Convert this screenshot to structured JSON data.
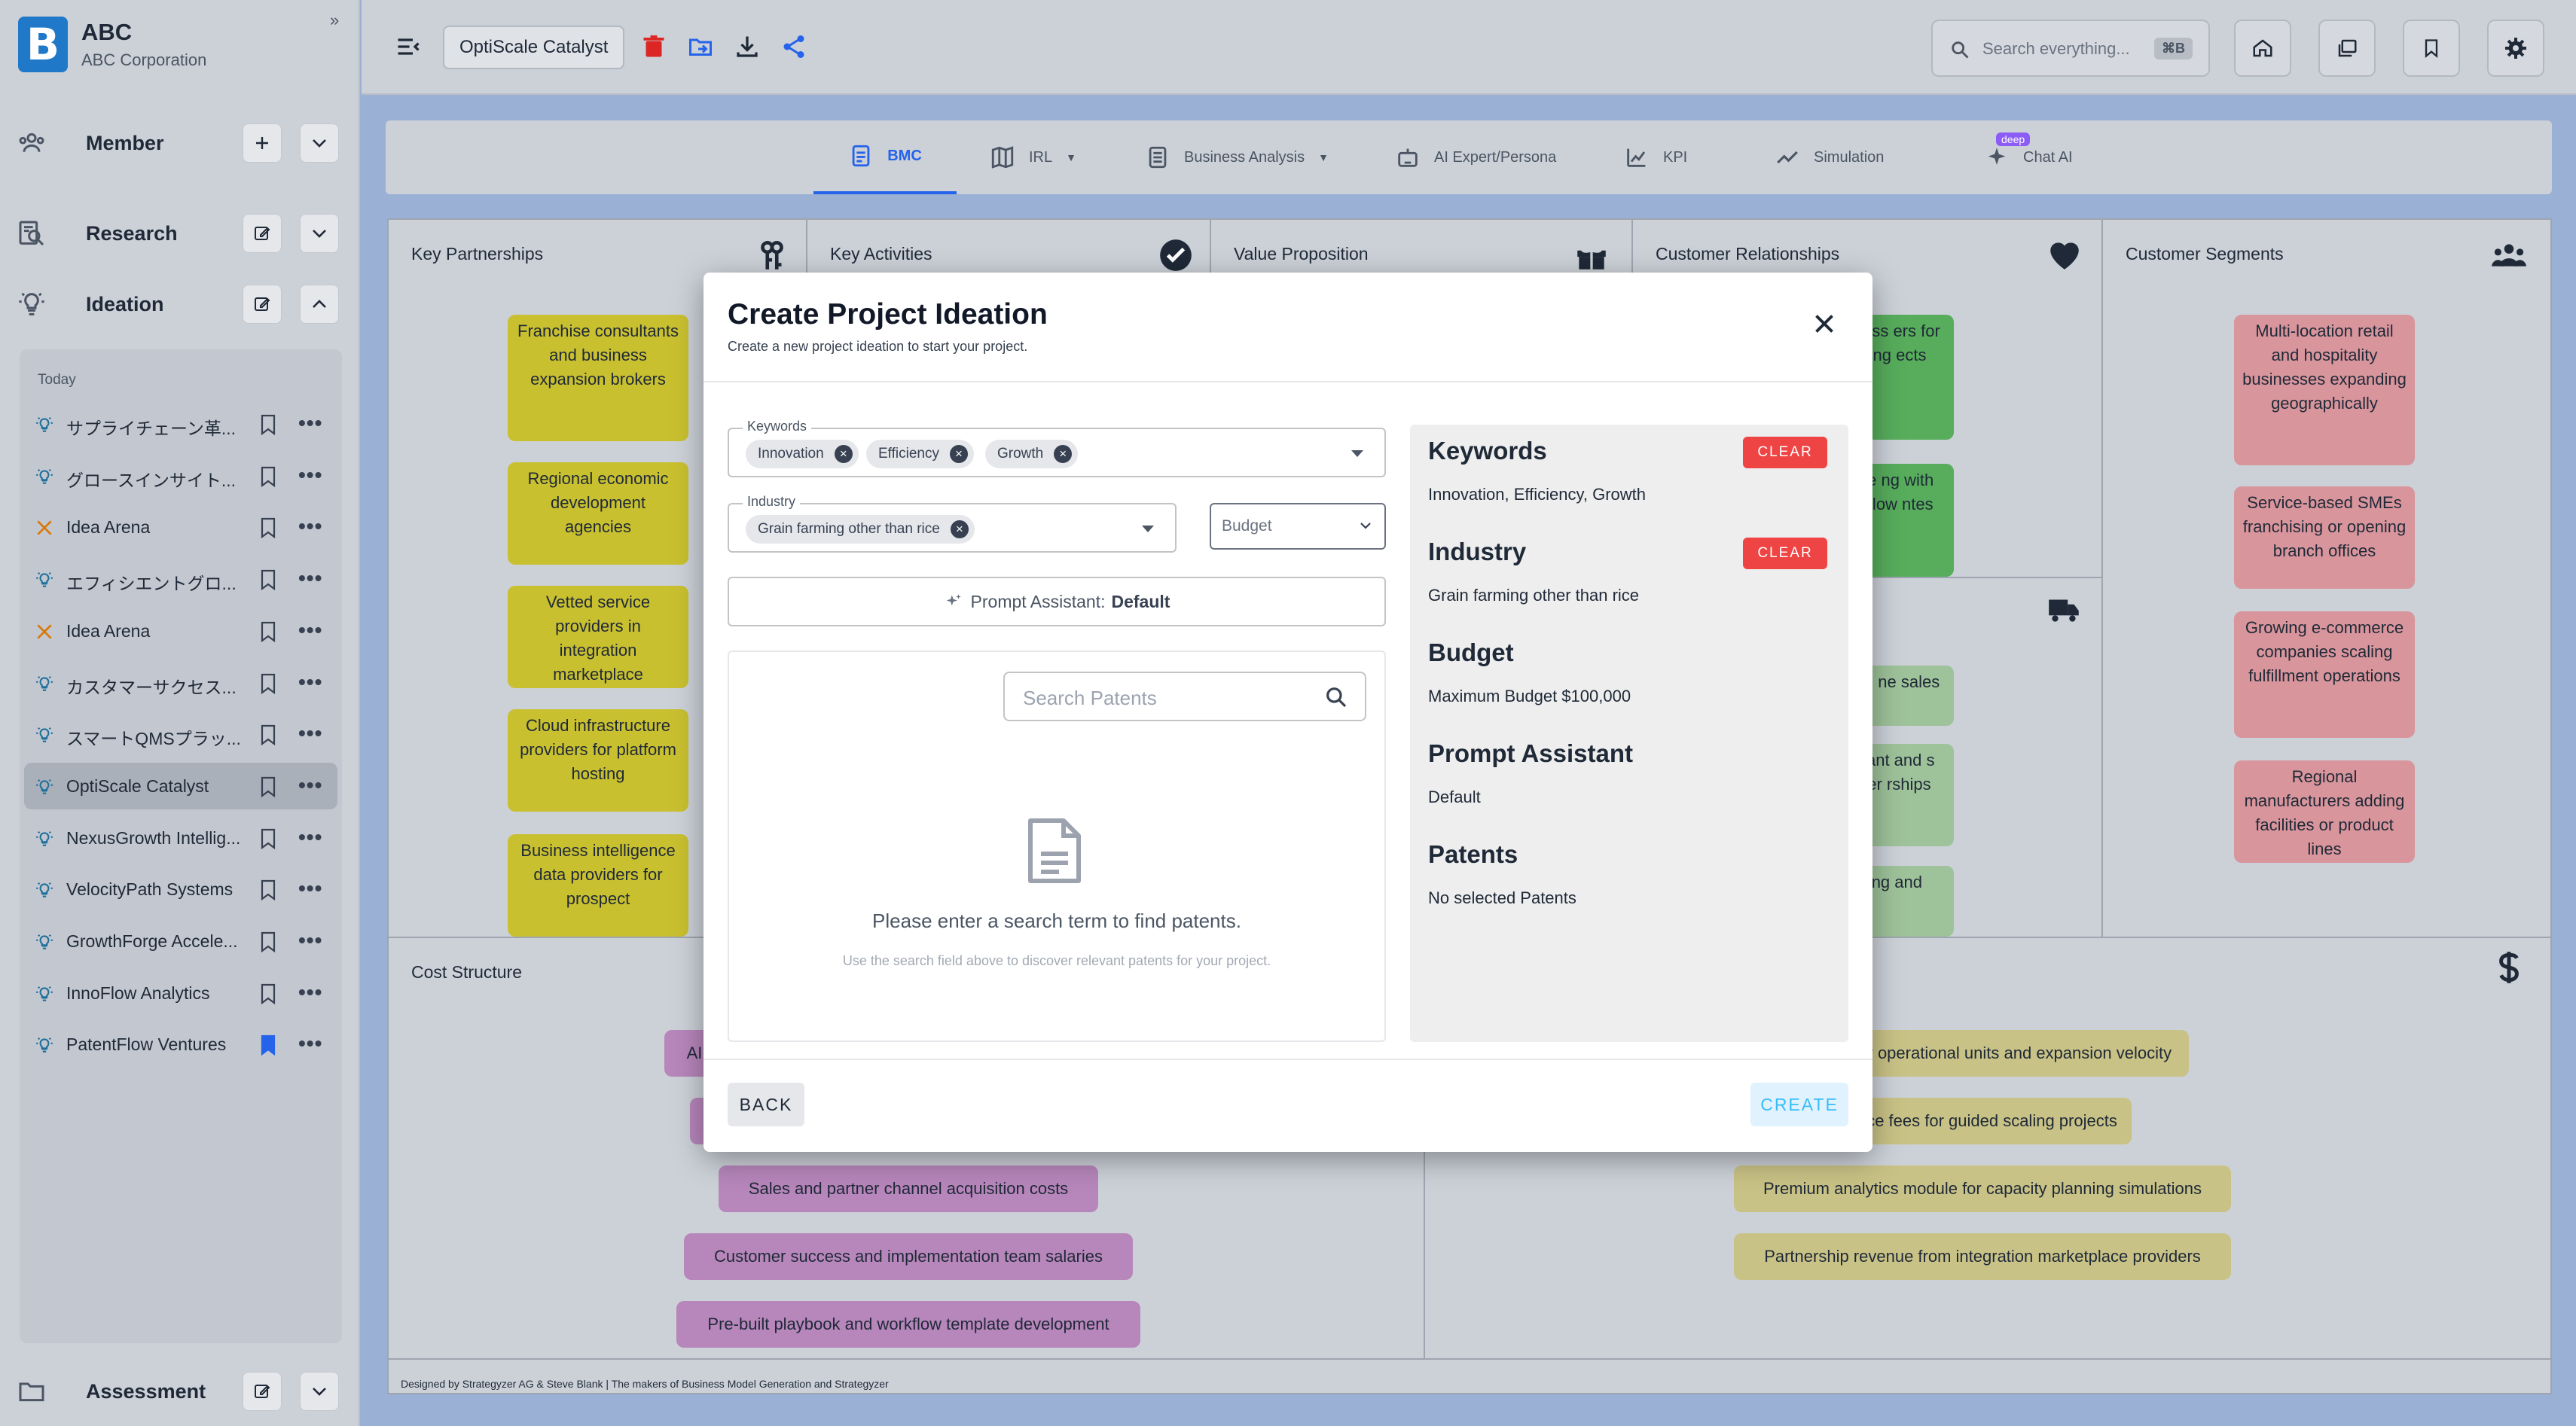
{
  "brand": {
    "logo_letter": "B",
    "name": "ABC",
    "subtitle": "ABC Corporation",
    "collapse_glyph": "»"
  },
  "sidebar": {
    "sections": [
      {
        "label": "Member",
        "icon": "group-icon"
      },
      {
        "label": "Research",
        "icon": "research-icon"
      },
      {
        "label": "Ideation",
        "icon": "lightbulb-icon"
      },
      {
        "label": "Assessment",
        "icon": "folder-icon"
      }
    ],
    "history_group": "Today",
    "history": [
      {
        "title": "サプライチェーン革...",
        "icon": "lightbulb-icon",
        "bookmarked": false
      },
      {
        "title": "グロースインサイト...",
        "icon": "lightbulb-icon",
        "bookmarked": false
      },
      {
        "title": "Idea Arena",
        "icon": "swords-icon",
        "bookmarked": false
      },
      {
        "title": "エフィシエントグロ...",
        "icon": "lightbulb-icon",
        "bookmarked": false
      },
      {
        "title": "Idea Arena",
        "icon": "swords-icon",
        "bookmarked": false
      },
      {
        "title": "カスタマーサクセス...",
        "icon": "lightbulb-icon",
        "bookmarked": false
      },
      {
        "title": "スマートQMSプラッ...",
        "icon": "lightbulb-icon",
        "bookmarked": false
      },
      {
        "title": "OptiScale Catalyst",
        "icon": "lightbulb-icon",
        "bookmarked": false,
        "selected": true
      },
      {
        "title": "NexusGrowth Intellig...",
        "icon": "lightbulb-icon",
        "bookmarked": false
      },
      {
        "title": "VelocityPath Systems",
        "icon": "lightbulb-icon",
        "bookmarked": false
      },
      {
        "title": "GrowthForge Accele...",
        "icon": "lightbulb-icon",
        "bookmarked": false
      },
      {
        "title": "InnoFlow Analytics",
        "icon": "lightbulb-icon",
        "bookmarked": false
      },
      {
        "title": "PatentFlow Ventures",
        "icon": "lightbulb-icon",
        "bookmarked": true
      }
    ],
    "more_glyph": "•••"
  },
  "topbar": {
    "project_name": "OptiScale Catalyst",
    "search_placeholder": "Search everything...",
    "search_shortcut": "⌘B",
    "accent_delete": "#dc2626",
    "accent_action": "#2563eb"
  },
  "tabs": [
    {
      "label": "BMC",
      "active": true,
      "icon": "document-icon"
    },
    {
      "label": "IRL",
      "dropdown": true,
      "icon": "map-icon"
    },
    {
      "label": "Business Analysis",
      "dropdown": true,
      "icon": "report-icon"
    },
    {
      "label": "AI Expert/Persona",
      "icon": "robot-icon"
    },
    {
      "label": "KPI",
      "icon": "chart-icon"
    },
    {
      "label": "Simulation",
      "icon": "trend-icon"
    },
    {
      "label": "Chat AI",
      "badge": "deep",
      "icon": "sparkle-icon"
    }
  ],
  "bmc": {
    "blocks": {
      "key_partnerships": "Key Partnerships",
      "key_activities": "Key Activities",
      "value_proposition": "Value Proposition",
      "customer_relationships": "Customer Relationships",
      "customer_segments": "Customer Segments",
      "cost_structure": "Cost Structure"
    },
    "key_partnerships_notes": [
      "Franchise consultants and business expansion brokers",
      "Regional economic development agencies",
      "Vetted service providers in integration marketplace",
      "Cloud infrastructure providers for platform hosting",
      "Business intelligence data providers for prospect"
    ],
    "customer_relationship_notes": [
      "ated ess ers for scaling ects",
      "ervice ng with iven flow ntes"
    ],
    "channel_notes": [
      "atform ne sales",
      "hise ant and s broker rships",
      "ent ng and"
    ],
    "customer_segments_notes": [
      "Multi-location retail and hospitality businesses expanding geographically",
      "Service-based SMEs franchising or opening branch offices",
      "Growing e-commerce companies scaling fulfillment operations",
      "Regional manufacturers adding facilities or product lines"
    ],
    "cost_notes": [
      "AI",
      "",
      "Sales and partner channel acquisition costs",
      "Customer success and implementation team salaries",
      "Pre-built playbook and workflow template development"
    ],
    "revenue_notes": [
      "iption by operational units and expansion velocity",
      "on service fees for guided scaling projects",
      "Premium analytics module for capacity planning simulations",
      "Partnership revenue from integration marketplace providers"
    ],
    "footer": "Designed by Strategyzer AG & Steve Blank | The makers of Business Model Generation and Strategyzer"
  },
  "modal": {
    "title": "Create Project Ideation",
    "subtitle": "Create a new project ideation to start your project.",
    "keywords_label": "Keywords",
    "keywords": [
      "Innovation",
      "Efficiency",
      "Growth"
    ],
    "industry_label": "Industry",
    "industry": "Grain farming other than rice",
    "budget_placeholder": "Budget",
    "prompt_assistant_label": "Prompt Assistant:",
    "prompt_assistant_value": "Default",
    "patent_search_placeholder": "Search Patents",
    "empty_title": "Please enter a search term to find patents.",
    "empty_subtitle": "Use the search field above to discover relevant patents for your project.",
    "summary": {
      "keywords_heading": "Keywords",
      "keywords_value": "Innovation, Efficiency, Growth",
      "industry_heading": "Industry",
      "industry_value": "Grain farming other than rice",
      "budget_heading": "Budget",
      "budget_value": "Maximum Budget $100,000",
      "prompt_heading": "Prompt Assistant",
      "prompt_value": "Default",
      "patents_heading": "Patents",
      "patents_value": "No selected Patents",
      "clear_label": "CLEAR"
    },
    "back_label": "BACK",
    "create_label": "CREATE",
    "close_glyph": "✕"
  }
}
